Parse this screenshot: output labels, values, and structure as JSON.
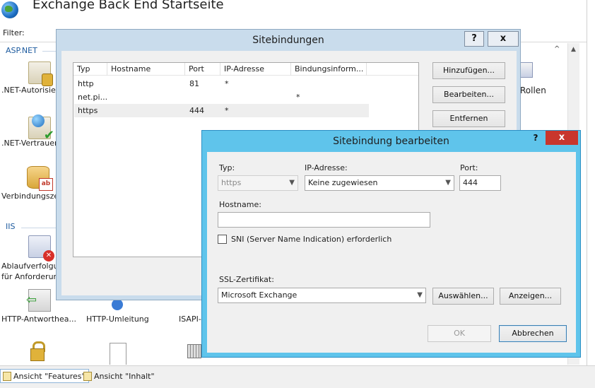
{
  "iis": {
    "heading": "Exchange Back End Startseite",
    "filter_label": "Filter:",
    "groups": {
      "aspnet": "ASP.NET",
      "iis": "IIS"
    },
    "features": [
      {
        "label": ".NET-Autorisie"
      },
      {
        "label": ".NET-Vertrauer"
      },
      {
        "label": "Verbindungsze"
      },
      {
        "label": "Ablaufverfolgu"
      },
      {
        "label": "für Anforderun"
      },
      {
        "label": "HTTP-Antworthea..."
      },
      {
        "label": "HTTP-Umleitung"
      },
      {
        "label": "ISAPI-"
      },
      {
        "label": "Rollen"
      }
    ],
    "views": {
      "features": "Ansicht \"Features\"",
      "content": "Ansicht \"Inhalt\""
    }
  },
  "sitebindings": {
    "title": "Sitebindungen",
    "help": "?",
    "close": "x",
    "columns": [
      "Typ",
      "Hostname",
      "Port",
      "IP-Adresse",
      "Bindungsinform..."
    ],
    "rows": [
      {
        "type": "http",
        "hostname": "",
        "port": "81",
        "ip": "*",
        "info": ""
      },
      {
        "type": "net.pi...",
        "hostname": "",
        "port": "",
        "ip": "",
        "info": "*"
      },
      {
        "type": "https",
        "hostname": "",
        "port": "444",
        "ip": "*",
        "info": ""
      }
    ],
    "buttons": {
      "add": "Hinzufügen...",
      "edit": "Bearbeiten...",
      "remove": "Entfernen"
    }
  },
  "edit_binding": {
    "title": "Sitebindung bearbeiten",
    "help": "?",
    "close": "x",
    "type_label": "Typ:",
    "type_value": "https",
    "ip_label": "IP-Adresse:",
    "ip_value": "Keine zugewiesen",
    "port_label": "Port:",
    "port_value": "444",
    "hostname_label": "Hostname:",
    "hostname_value": "",
    "sni_label": "SNI (Server Name Indication) erforderlich",
    "sni_checked": false,
    "ssl_label": "SSL-Zertifikat:",
    "ssl_value": "Microsoft Exchange",
    "select_button": "Auswählen...",
    "view_button": "Anzeigen...",
    "ok_button": "OK",
    "cancel_button": "Abbrechen"
  }
}
